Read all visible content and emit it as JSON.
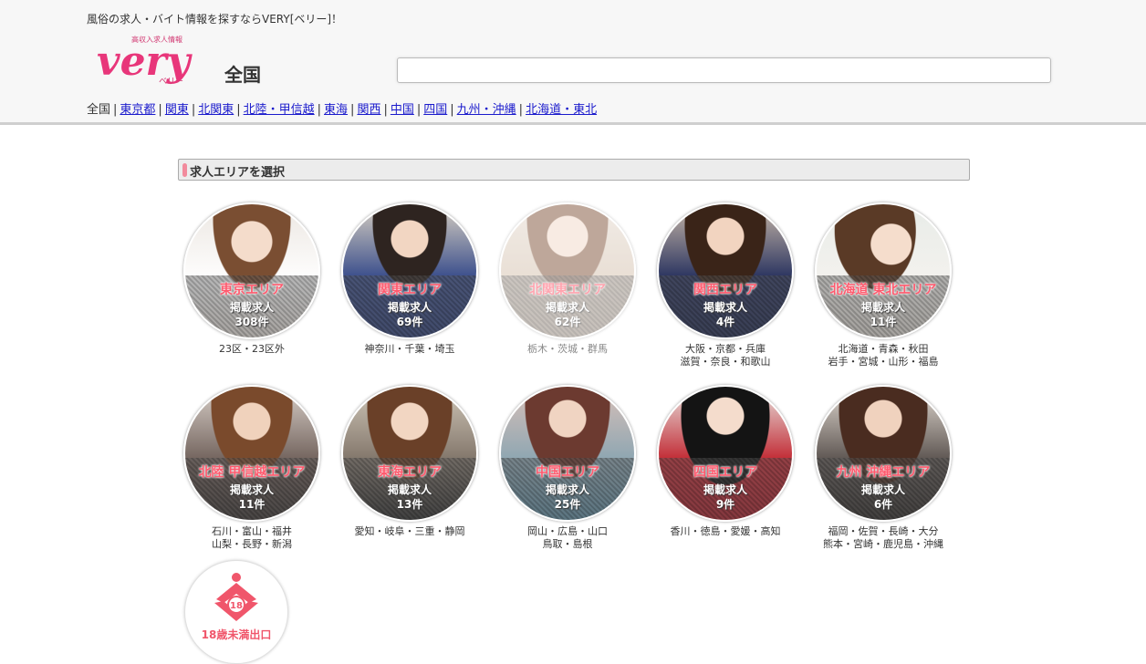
{
  "header": {
    "tagline": "風俗の求人・バイト情報を探すならVERY[ベリー]！",
    "logo": {
      "main": "very",
      "sub_top": "高収入求人情報",
      "sub_bottom": "ベリー"
    },
    "region_label": "全国",
    "search": {
      "value": "",
      "placeholder": ""
    }
  },
  "region_nav": {
    "current": "全国",
    "links": [
      "東京都",
      "関東",
      "北関東",
      "北陸・甲信越",
      "東海",
      "関西",
      "中国",
      "四国",
      "九州・沖縄",
      "北海道・東北"
    ]
  },
  "section_title": "求人エリアを選択",
  "areas": [
    {
      "name": "東京エリア",
      "label": "掲載求人",
      "count": "308件",
      "prefs1": "23区・23区外",
      "prefs2": ""
    },
    {
      "name": "関東エリア",
      "label": "掲載求人",
      "count": "69件",
      "prefs1": "神奈川・千葉・埼玉",
      "prefs2": ""
    },
    {
      "name": "北関東エリア",
      "label": "掲載求人",
      "count": "62件",
      "prefs1": "栃木・茨城・群馬",
      "prefs2": ""
    },
    {
      "name": "関西エリア",
      "label": "掲載求人",
      "count": "4件",
      "prefs1": "大阪・京都・兵庫",
      "prefs2": "滋賀・奈良・和歌山"
    },
    {
      "name": "北海道 東北エリア",
      "label": "掲載求人",
      "count": "11件",
      "prefs1": "北海道・青森・秋田",
      "prefs2": "岩手・宮城・山形・福島"
    },
    {
      "name": "北陸 甲信越エリア",
      "label": "掲載求人",
      "count": "11件",
      "prefs1": "石川・富山・福井",
      "prefs2": "山梨・長野・新潟"
    },
    {
      "name": "東海エリア",
      "label": "掲載求人",
      "count": "13件",
      "prefs1": "愛知・岐阜・三重・静岡",
      "prefs2": ""
    },
    {
      "name": "中国エリア",
      "label": "掲載求人",
      "count": "25件",
      "prefs1": "岡山・広島・山口",
      "prefs2": "鳥取・島根"
    },
    {
      "name": "四国エリア",
      "label": "掲載求人",
      "count": "9件",
      "prefs1": "香川・徳島・愛媛・高知",
      "prefs2": ""
    },
    {
      "name": "九州 沖縄エリア",
      "label": "掲載求人",
      "count": "6件",
      "prefs1": "福岡・佐賀・長崎・大分",
      "prefs2": "熊本・宮崎・鹿児島・沖縄"
    }
  ],
  "exit": {
    "label": "18歳未満出口",
    "badge": "18"
  },
  "colors": {
    "accent_pink": "#f28a9c",
    "area_name": "#ff5a6e",
    "link": "#1a1acc"
  }
}
